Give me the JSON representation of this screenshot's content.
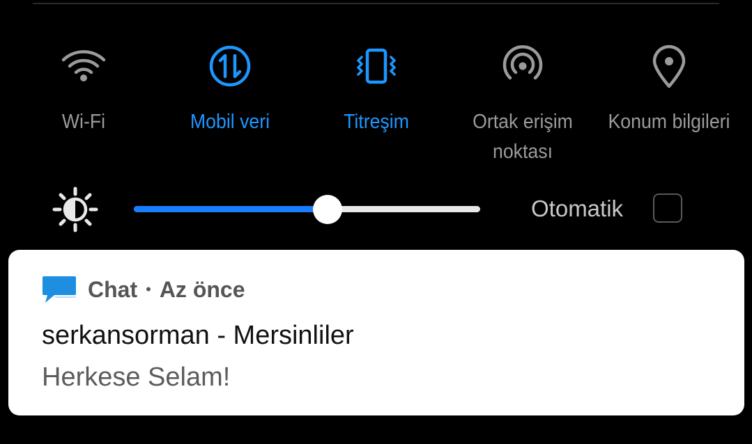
{
  "quick_settings": {
    "tiles": [
      {
        "label": "Wi-Fi",
        "icon": "wifi-icon",
        "active": false
      },
      {
        "label": "Mobil veri",
        "icon": "mobile-data-icon",
        "active": true
      },
      {
        "label": "Titreşim",
        "icon": "vibrate-icon",
        "active": true
      },
      {
        "label": "Ortak erişim\nnoktası",
        "icon": "hotspot-icon",
        "active": false
      },
      {
        "label": "Konum bilgileri",
        "icon": "location-pin-icon",
        "active": false
      }
    ],
    "colors": {
      "active": "#1e96ff",
      "inactive": "#9b9b9b",
      "background": "#000000"
    }
  },
  "brightness": {
    "icon": "brightness-icon",
    "level_fraction": 0.56,
    "auto_label": "Otomatik",
    "auto_checked": false
  },
  "notification": {
    "app_icon": "chat-bubble-icon",
    "app_name": "Chat",
    "separator": "•",
    "time": "Az önce",
    "title": "serkansorman - Mersinliler",
    "text": "Herkese Selam!",
    "icon_color": "#1e8ee0"
  }
}
